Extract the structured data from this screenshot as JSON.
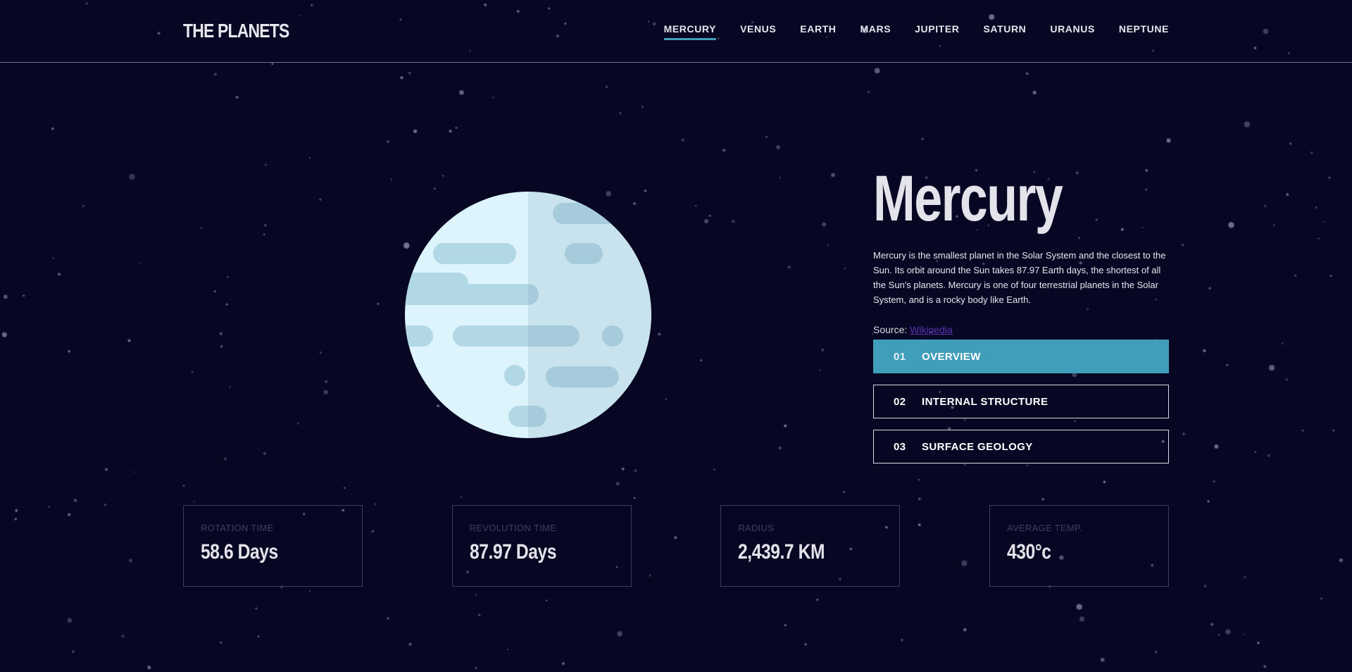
{
  "header": {
    "logo": "THE PLANETS",
    "nav": [
      {
        "label": "MERCURY",
        "active": true
      },
      {
        "label": "VENUS",
        "active": false
      },
      {
        "label": "EARTH",
        "active": false
      },
      {
        "label": "MARS",
        "active": false
      },
      {
        "label": "JUPITER",
        "active": false
      },
      {
        "label": "SATURN",
        "active": false
      },
      {
        "label": "URANUS",
        "active": false
      },
      {
        "label": "NEPTUNE",
        "active": false
      }
    ]
  },
  "planet": {
    "name": "Mercury",
    "description": "Mercury is the smallest planet in the Solar System and the closest to the Sun. Its orbit around the Sun takes 87.97 Earth days, the shortest of all the Sun's planets. Mercury is one of four terrestrial planets in the Solar System, and is a rocky body like Earth.",
    "source_label": "Source:",
    "source_link": "Wikipedia"
  },
  "tabs": [
    {
      "num": "01",
      "label": "OVERVIEW",
      "active": true
    },
    {
      "num": "02",
      "label": "INTERNAL STRUCTURE",
      "active": false
    },
    {
      "num": "03",
      "label": "SURFACE GEOLOGY",
      "active": false
    }
  ],
  "stats": [
    {
      "label": "ROTATION TIME",
      "value": "58.6 Days"
    },
    {
      "label": "REVOLUTION TIME",
      "value": "87.97 Days"
    },
    {
      "label": "RADIUS",
      "value": "2,439.7 KM"
    },
    {
      "label": "AVERAGE TEMP.",
      "value": "430°c"
    }
  ],
  "colors": {
    "background": "#070724",
    "accent": "#419ebb",
    "link": "#5b32b8",
    "planet_light": "#def4fc",
    "planet_shade": "#cde3ea",
    "planet_spots": "#b2d7e5"
  }
}
